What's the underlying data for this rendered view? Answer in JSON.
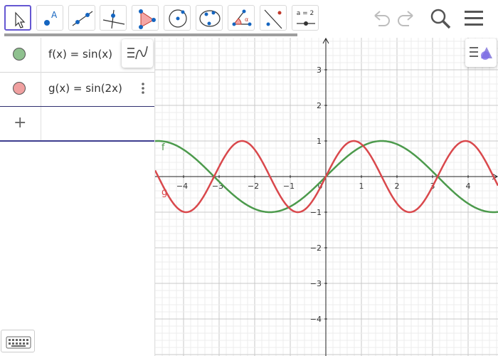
{
  "toolbar": {
    "tools": [
      {
        "name": "move-tool",
        "text": ""
      },
      {
        "name": "point-tool",
        "text": ""
      },
      {
        "name": "line-tool",
        "text": ""
      },
      {
        "name": "perpendicular-line-tool",
        "text": ""
      },
      {
        "name": "polygon-tool",
        "text": ""
      },
      {
        "name": "circle-tool",
        "text": ""
      },
      {
        "name": "conic-tool",
        "text": ""
      },
      {
        "name": "angle-tool",
        "text": ""
      },
      {
        "name": "reflect-tool",
        "text": ""
      },
      {
        "name": "slider-tool",
        "text": "a = 2"
      }
    ],
    "right_icons": [
      "undo-icon",
      "redo-icon",
      "search-icon",
      "menu-icon"
    ]
  },
  "algebra": {
    "items": [
      {
        "expr": "f(x) = sin(x)",
        "color": "#4c9a4c"
      },
      {
        "expr": "g(x) = sin(2x)",
        "color": "#e07070"
      }
    ],
    "add_symbol": "+"
  },
  "colors": {
    "accent": "#6557d2",
    "f": "#4c9a4c",
    "g": "#d9484c"
  },
  "chart_data": {
    "type": "line",
    "xlim": [
      -4.7,
      4.9
    ],
    "ylim": [
      -5,
      3.9
    ],
    "x_ticks": [
      "−4",
      "−3",
      "−2",
      "−1",
      "0",
      "1",
      "2",
      "3",
      "4"
    ],
    "y_ticks": [
      "3",
      "2",
      "1",
      "−1",
      "−2",
      "−3",
      "−4"
    ],
    "grid": true,
    "series": [
      {
        "name": "f",
        "formula": "sin(x)",
        "color": "#4c9a4c"
      },
      {
        "name": "g",
        "formula": "sin(2x)",
        "color": "#d9484c"
      }
    ]
  }
}
